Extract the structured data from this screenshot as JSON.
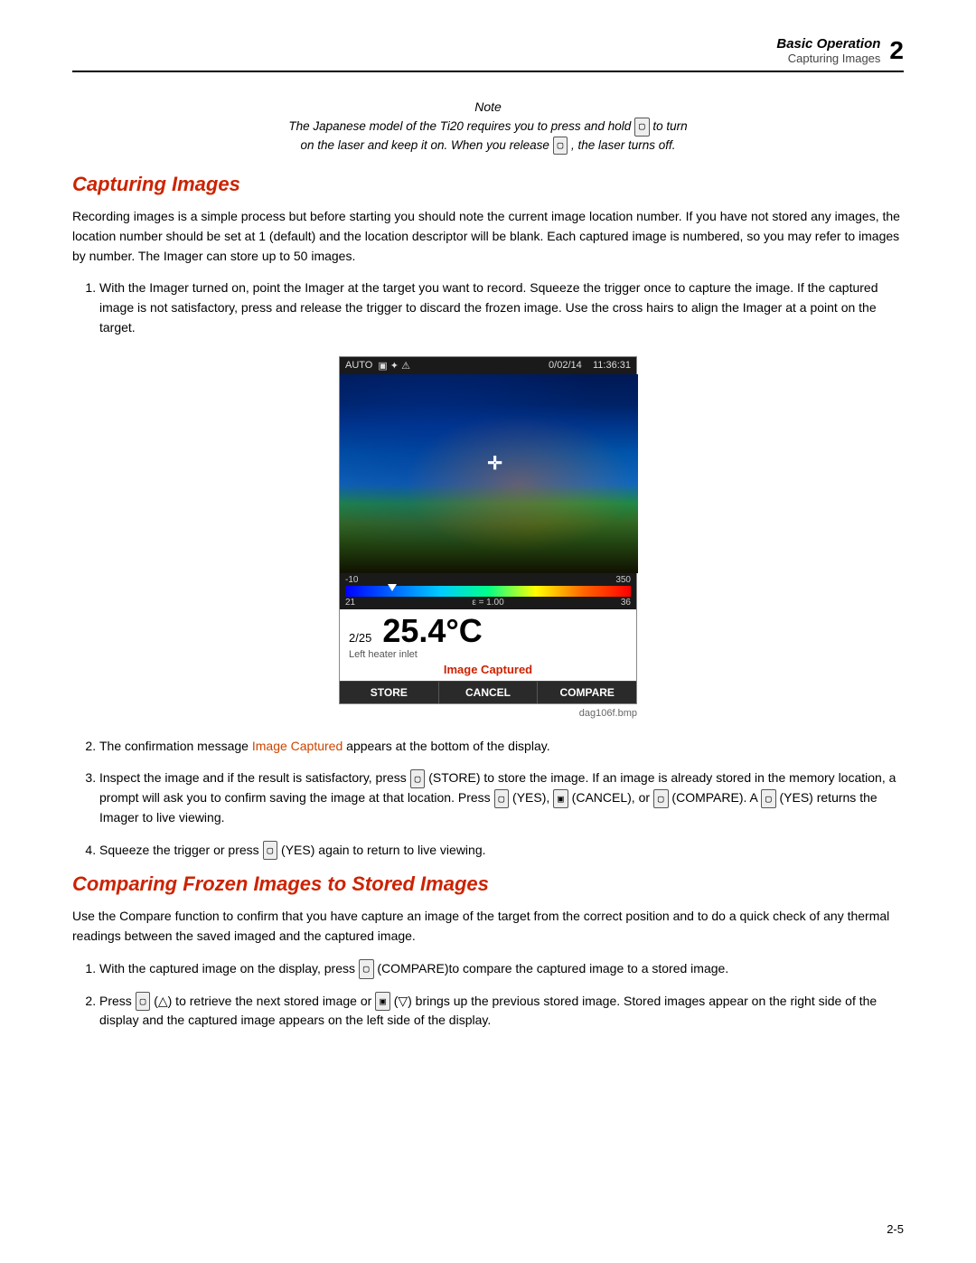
{
  "header": {
    "title_italic": "Basic Operation",
    "subtitle": "Capturing Images",
    "chapter_number": "2"
  },
  "note": {
    "label": "Note",
    "text": "The Japanese model of the Ti20 requires you to press and hold  □  to turn\non the laser and keep it on. When you release  □ , the laser turns off."
  },
  "section1": {
    "heading": "Capturing Images",
    "intro": "Recording images is a simple process but before starting you should note the current image location number. If you have not stored any images, the location number should be set at 1 (default) and the location descriptor will be blank. Each captured image is numbered, so you may refer to images by number. The Imager can store up to 50 images.",
    "steps": [
      "With the Imager turned on, point the Imager at the target you want to record. Squeeze the trigger once to capture the image. If the captured image is not satisfactory, press and release the trigger to discard the frozen image. Use the cross hairs to align the Imager at a point on the target.",
      "The confirmation message Image Captured appears at the bottom of the display.",
      "Inspect the image and if the result is satisfactory, press □ (STORE) to store the image. If an image is already stored in the memory location, a prompt will ask you to confirm saving the image at that location. Press □ (YES), □ (CANCEL), or □ (COMPARE). A □ (YES) returns the Imager to live viewing.",
      "Squeeze the trigger or press □ (YES) again to return to live viewing."
    ]
  },
  "thermal_display": {
    "topbar_mode": "AUTO",
    "topbar_date": "0/02/14",
    "topbar_time": "11:36:31",
    "scale_min": "-10",
    "scale_max": "350",
    "scale_low": "21",
    "scale_high": "36",
    "epsilon": "ε = 1.00",
    "image_counter": "2/25",
    "temperature": "25.4°C",
    "location": "Left heater inlet",
    "image_captured_label": "Image Captured",
    "buttons": [
      "STORE",
      "CANCEL",
      "COMPARE"
    ]
  },
  "image_caption": "dag106f.bmp",
  "section2": {
    "heading": "Comparing Frozen Images to Stored Images",
    "intro": "Use the Compare function to confirm that you have capture an image of the target from the correct position and to do a quick check of any thermal readings between the saved imaged and the captured image.",
    "steps": [
      "With the captured image on the display, press □ (COMPARE)to compare the captured image to a stored image.",
      "Press □ (△) to retrieve the next stored image or □ (▽) brings up the previous stored image. Stored images appear on the right side of the display and the captured image appears on the left side of the display."
    ]
  },
  "footer": {
    "page_number": "2-5"
  }
}
